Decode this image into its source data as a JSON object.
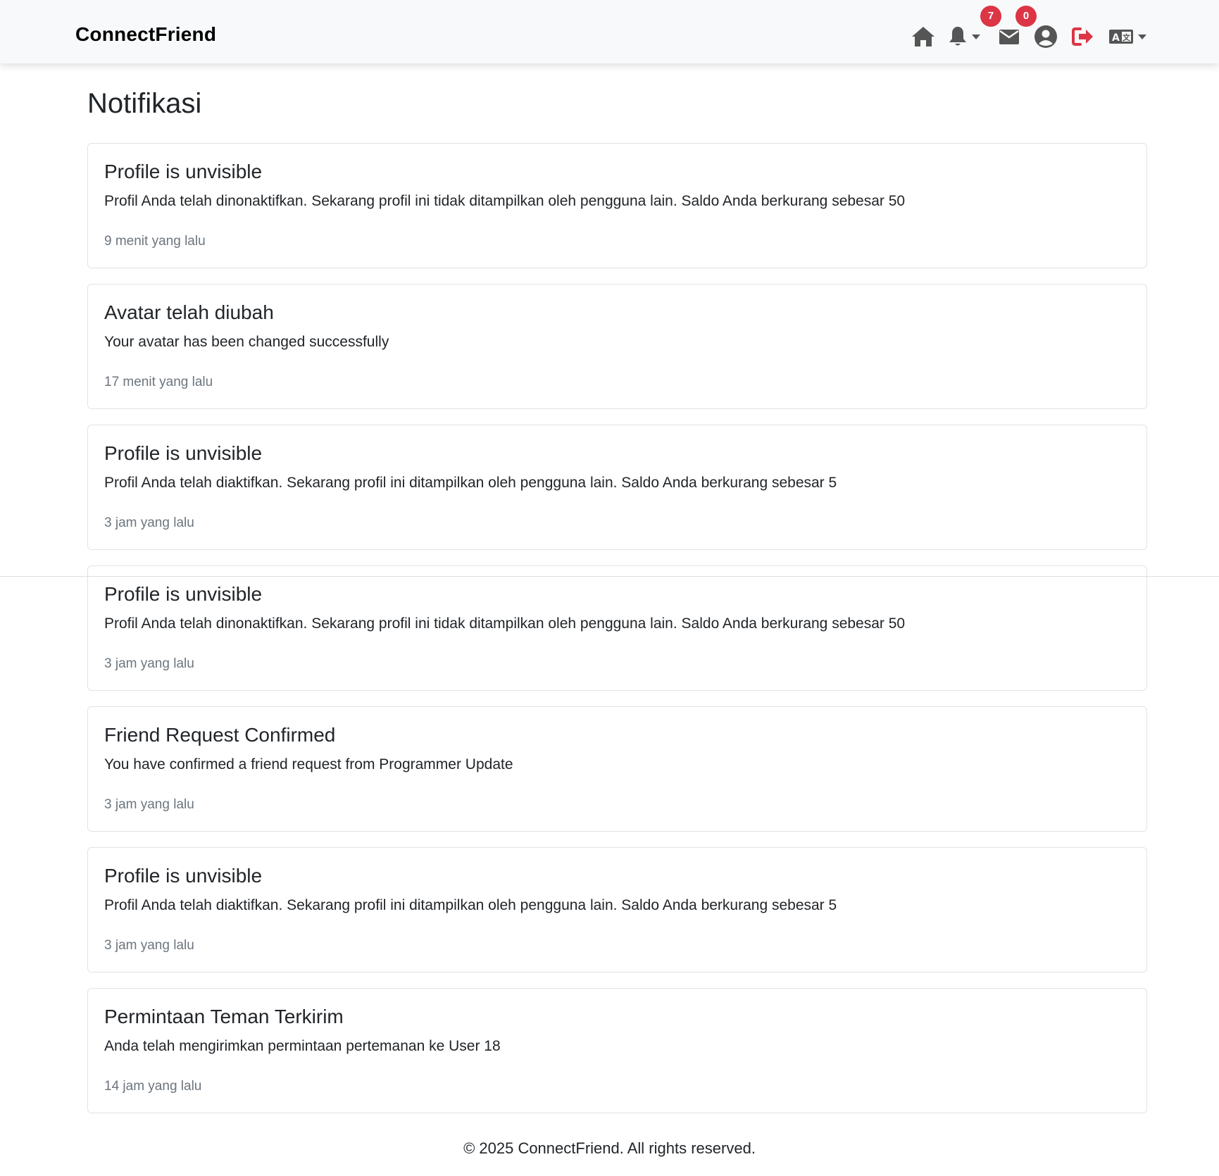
{
  "navbar": {
    "brand": "ConnectFriend",
    "notifications_badge": "7",
    "messages_badge": "0",
    "icons": [
      "home-icon",
      "bell-icon",
      "envelope-icon",
      "user-circle-icon",
      "logout-icon",
      "language-icon"
    ],
    "colors": {
      "badge": "#dc3545",
      "logout": "#dc3545",
      "icon": "#555555",
      "background": "#f8f9fa"
    }
  },
  "page": {
    "title": "Notifikasi"
  },
  "notifications": [
    {
      "title": "Profile is unvisible",
      "body": "Profil Anda telah dinonaktifkan. Sekarang profil ini tidak ditampilkan oleh pengguna lain. Saldo Anda berkurang sebesar 50",
      "time": "9 menit yang lalu"
    },
    {
      "title": "Avatar telah diubah",
      "body": "Your avatar has been changed successfully",
      "time": "17 menit yang lalu"
    },
    {
      "title": "Profile is unvisible",
      "body": "Profil Anda telah diaktifkan. Sekarang profil ini ditampilkan oleh pengguna lain. Saldo Anda berkurang sebesar 5",
      "time": "3 jam yang lalu"
    },
    {
      "title": "Profile is unvisible",
      "body": "Profil Anda telah dinonaktifkan. Sekarang profil ini tidak ditampilkan oleh pengguna lain. Saldo Anda berkurang sebesar 50",
      "time": "3 jam yang lalu"
    },
    {
      "title": "Friend Request Confirmed",
      "body": "You have confirmed a friend request from Programmer Update",
      "time": "3 jam yang lalu"
    },
    {
      "title": "Profile is unvisible",
      "body": "Profil Anda telah diaktifkan. Sekarang profil ini ditampilkan oleh pengguna lain. Saldo Anda berkurang sebesar 5",
      "time": "3 jam yang lalu"
    },
    {
      "title": "Permintaan Teman Terkirim",
      "body": "Anda telah mengirimkan permintaan pertemanan ke User 18",
      "time": "14 jam yang lalu"
    }
  ],
  "footer": {
    "text": "© 2025 ConnectFriend. All rights reserved."
  }
}
